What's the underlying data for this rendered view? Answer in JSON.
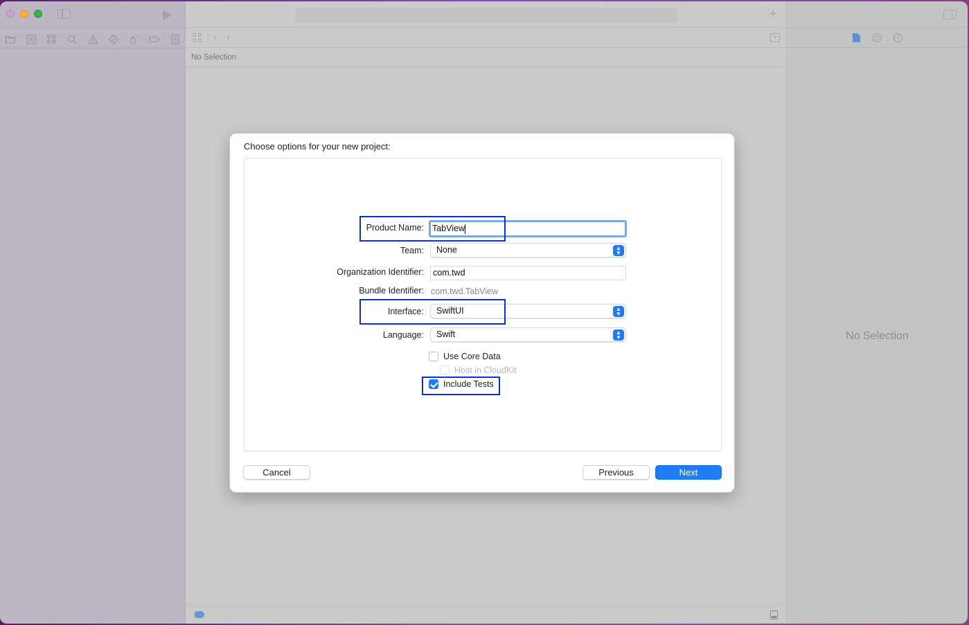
{
  "sidebar": {
    "navigator_icons": [
      {
        "name": "folder-icon"
      },
      {
        "name": "source-control-icon"
      },
      {
        "name": "symbol-hierarchy-icon"
      },
      {
        "name": "search-icon"
      },
      {
        "name": "warning-icon"
      },
      {
        "name": "test-diamond-icon"
      },
      {
        "name": "debug-spray-icon"
      },
      {
        "name": "breakpoint-tag-icon"
      },
      {
        "name": "report-list-icon"
      }
    ]
  },
  "editor": {
    "path_text": "No Selection",
    "nav_back": "‹",
    "nav_forward": "›",
    "add_label": "+"
  },
  "inspector": {
    "empty_text": "No Selection",
    "tabs": [
      "file-inspector",
      "history-inspector",
      "quick-help-inspector"
    ],
    "history_glyph": "◷",
    "help_glyph": "?"
  },
  "dialog": {
    "title": "Choose options for your new project:",
    "fields": {
      "product_name": {
        "label": "Product Name:",
        "value": "TabView"
      },
      "team": {
        "label": "Team:",
        "value": "None"
      },
      "org_identifier": {
        "label": "Organization Identifier:",
        "value": "com.twd"
      },
      "bundle_identifier": {
        "label": "Bundle Identifier:",
        "value": "com.twd.TabView"
      },
      "interface": {
        "label": "Interface:",
        "value": "SwiftUI"
      },
      "language": {
        "label": "Language:",
        "value": "Swift"
      }
    },
    "checkboxes": {
      "use_core_data": {
        "label": "Use Core Data",
        "checked": false
      },
      "host_in_cloudkit": {
        "label": "Host in CloudKit",
        "checked": false,
        "disabled": true
      },
      "include_tests": {
        "label": "Include Tests",
        "checked": true
      }
    },
    "buttons": {
      "cancel": "Cancel",
      "previous": "Previous",
      "next": "Next"
    },
    "select_arrow_glyph": "⌃⌄"
  },
  "colors": {
    "accent": "#1f7cf4",
    "highlight_box": "#0a2fd6",
    "focus_ring": "#7aa7e6"
  }
}
